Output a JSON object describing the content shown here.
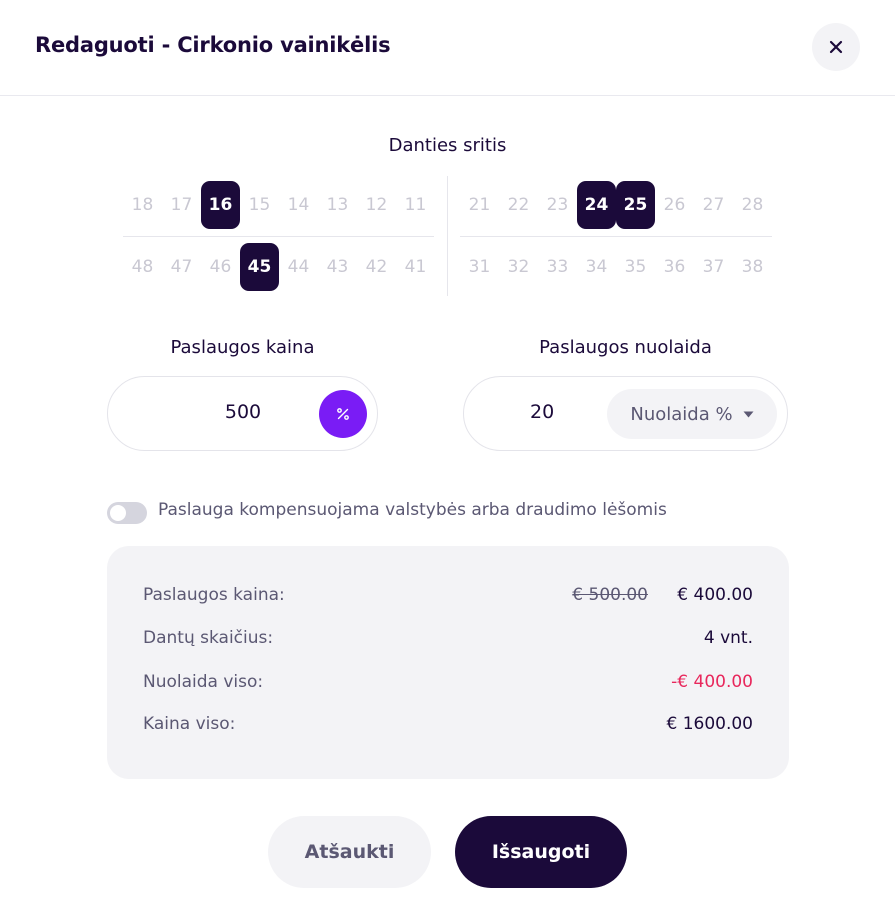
{
  "dialog": {
    "title": "Redaguoti - Cirkonio vainikėlis"
  },
  "teeth": {
    "title": "Danties sritis",
    "upper_left": [
      "18",
      "17",
      "16",
      "15",
      "14",
      "13",
      "12",
      "11"
    ],
    "upper_right": [
      "21",
      "22",
      "23",
      "24",
      "25",
      "26",
      "27",
      "28"
    ],
    "lower_left": [
      "48",
      "47",
      "46",
      "45",
      "44",
      "43",
      "42",
      "41"
    ],
    "lower_right": [
      "31",
      "32",
      "33",
      "34",
      "35",
      "36",
      "37",
      "38"
    ],
    "selected": [
      "16",
      "24",
      "25",
      "45"
    ]
  },
  "price": {
    "label": "Paslaugos kaina",
    "value": "500",
    "percent_icon": "percent-icon"
  },
  "discount": {
    "label": "Paslaugos nuolaida",
    "value": "20",
    "type_selected": "Nuolaida %"
  },
  "compensation": {
    "label": "Paslauga kompensuojama valstybės arba draudimo lėšomis",
    "enabled": false
  },
  "summary": {
    "price_label": "Paslaugos kaina:",
    "price_old": "€ 500.00",
    "price_new": "€ 400.00",
    "count_label": "Dantų skaičius:",
    "count_value": "4 vnt.",
    "discount_label": "Nuolaida viso:",
    "discount_value": "-€ 400.00",
    "total_label": "Kaina viso:",
    "total_value": "€ 1600.00"
  },
  "actions": {
    "cancel": "Atšaukti",
    "save": "Išsaugoti"
  },
  "colors": {
    "primary": "#1b0a3a",
    "accent": "#7a1cf5",
    "negative": "#e8275c",
    "muted": "#5b5873"
  }
}
